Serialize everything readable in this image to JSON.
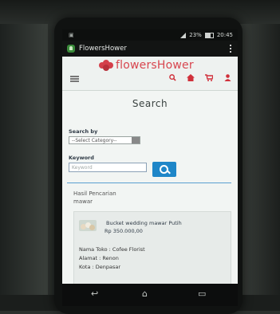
{
  "status": {
    "battery": "23%",
    "time": "20:45"
  },
  "app": {
    "title": "FlowersHower"
  },
  "site": {
    "logo_text": "flowersHower"
  },
  "page": {
    "title": "Search"
  },
  "form": {
    "search_by_label": "Search by",
    "select_value": "--Select Category--",
    "keyword_label": "Keyword",
    "keyword_placeholder": "Keyword"
  },
  "results": {
    "heading": "Hasil Pencarian",
    "query": "mawar",
    "items": [
      {
        "name": "Bucket wedding mawar Putih",
        "price": "Rp 350.000,00",
        "toko": "Nama Toko : Cofee Florist",
        "alamat": "Alamat : Renon",
        "kota": "Kota : Denpasar"
      }
    ]
  },
  "icons": {
    "search": "search-icon",
    "home": "home-icon",
    "cart": "cart-icon",
    "user": "user-icon",
    "menu": "hamburger-menu-icon"
  },
  "colors": {
    "brand": "#d8464f",
    "accent": "#1e86c8"
  }
}
